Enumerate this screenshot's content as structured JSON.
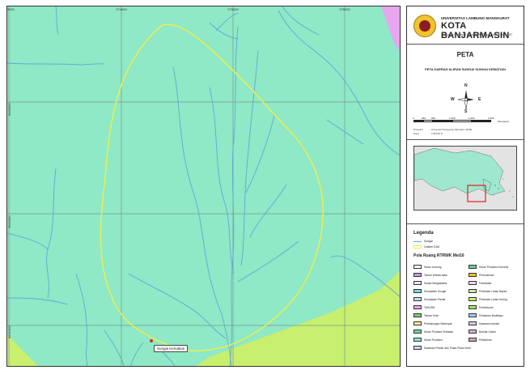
{
  "map": {
    "ticks_top": [
      "273000",
      "274000",
      "275000",
      "276000"
    ],
    "ticks_left": [
      "9653000",
      "9652000",
      "9651000"
    ],
    "callout_label": "Sungai Kematian",
    "colors": {
      "background": "#8fe8c6",
      "grid": "#7a9a8e",
      "river": "#5fa9d6",
      "boundary": "#e4ef55",
      "green_zone": "#c8ef6e",
      "purple_zone": "#e8a6ef"
    }
  },
  "header": {
    "university": "UNIVERSITAS LAMBUNG MANGKURAT",
    "city": "KOTA BANJARMASIN",
    "address": "Jl. Brigjen H. Hasan Basry Kayu Tangi, Kotak Pos No. 87"
  },
  "title": "PETA",
  "subtitle": "PETA DAERAH ALIRAN SUNGAI SUNGAI KEMATIAN",
  "compass": {
    "n": "N",
    "s": "S",
    "e": "E",
    "w": "W"
  },
  "scalebar": {
    "labels": [
      "0",
      "250",
      "500",
      "1.000",
      "1.500",
      "2.000"
    ],
    "unit": "Kilometers"
  },
  "projection": {
    "label1": "Proyeksi",
    "value1": ": Universal Transverse Mercator (UTM)",
    "label2": "Zona",
    "value2": ": UTM 50 S"
  },
  "legend": {
    "title": "Legenda",
    "items": [
      {
        "label": "Sungai",
        "color": "#5fa9d6"
      },
      {
        "label": "Outline DAS",
        "color": "#e4ef55"
      }
    ],
    "pola_title": "Pola Ruang RTRWK Mei16",
    "zones_left": [
      {
        "label": "Hutan Lindung",
        "color": "#ffffff"
      },
      {
        "label": "Taman Wisata Alam",
        "color": "#c89ae6"
      },
      {
        "label": "Suaka Margasatwa",
        "color": "#efe2f7"
      },
      {
        "label": "Sempadan Sungai",
        "color": "#7fd4e6"
      },
      {
        "label": "Sempadan Pantai",
        "color": "#b8e8f0"
      },
      {
        "label": "TAHURA",
        "color": "#e8a6ef"
      },
      {
        "label": "Taman Kota",
        "color": "#8ec87a"
      },
      {
        "label": "Perlindungan Setempat",
        "color": "#f3ef9a"
      },
      {
        "label": "Hutan Produksi Terbatas",
        "color": "#6fd6a6"
      },
      {
        "label": "Hutan Produksi",
        "color": "#8fe8c6"
      },
      {
        "label": "Kawasan Pesisir dan Pulau-Pulau Kecil",
        "color": "#d6d0ef"
      }
    ],
    "zones_right": [
      {
        "label": "Hutan Produksi Konversi",
        "color": "#6fcf8e"
      },
      {
        "label": "Permukiman",
        "color": "#f2c12e"
      },
      {
        "label": "Pariwisata",
        "color": "#f6d3ef"
      },
      {
        "label": "Pertanian Lahan Basah",
        "color": "#cde8a6"
      },
      {
        "label": "Pertanian Lahan Kering",
        "color": "#c8ef6e"
      },
      {
        "label": "Perkebunan",
        "color": "#a9e06a"
      },
      {
        "label": "Perikanan Budidaya",
        "color": "#9fd0ef"
      },
      {
        "label": "Kawasan Industri",
        "color": "#d9cde0"
      },
      {
        "label": "Bandar Udara",
        "color": "#c9b3d6"
      },
      {
        "label": "Pelabuhan",
        "color": "#d9a0c0"
      }
    ]
  }
}
